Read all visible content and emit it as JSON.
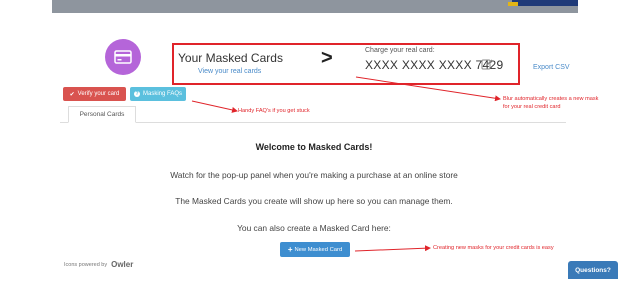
{
  "header": {
    "title": "Your Masked Cards",
    "view_link": "View your real cards",
    "chevron_glyph": ">",
    "charge_label": "Charge your real card:",
    "card_number": "XXXX XXXX XXXX 7429",
    "export_label": "Export CSV"
  },
  "actions": {
    "verify_label": "Verify your card",
    "faq_label": "Masking FAQs"
  },
  "tabs": [
    {
      "label": "Personal Cards",
      "active": true
    }
  ],
  "main": {
    "welcome": "Welcome to Masked Cards!",
    "para1": "Watch for the pop-up panel when you're making a purchase at an online store",
    "para2": "The Masked Cards you create will show up here so you can manage them.",
    "para3": "You can also create a Masked Card here:",
    "new_button": "New Masked Card"
  },
  "footer": {
    "icons_powered_by": "Icons powered by",
    "brand": "Owler",
    "questions_label": "Questions?"
  },
  "annotations": {
    "faq_note": "Handy FAQ's if you get stuck",
    "blur_note_line1": "Blur automatically creates a new mask",
    "blur_note_line2": "for your real credit card",
    "new_mask_note": "Creating new masks for your credit cards is easy"
  },
  "colors": {
    "accent_red": "#e0242a",
    "button_blue": "#3e8ed0",
    "avatar_purple": "#b565d9",
    "verify_red": "#d9534f",
    "faq_cyan": "#5bc0de",
    "link_blue": "#4a8bc9"
  },
  "icons": {
    "avatar": "credit-card-icon",
    "edit": "pencil-edit-icon",
    "verify": "check-circle-icon",
    "faq": "info-circle-icon",
    "new": "plus-icon"
  }
}
